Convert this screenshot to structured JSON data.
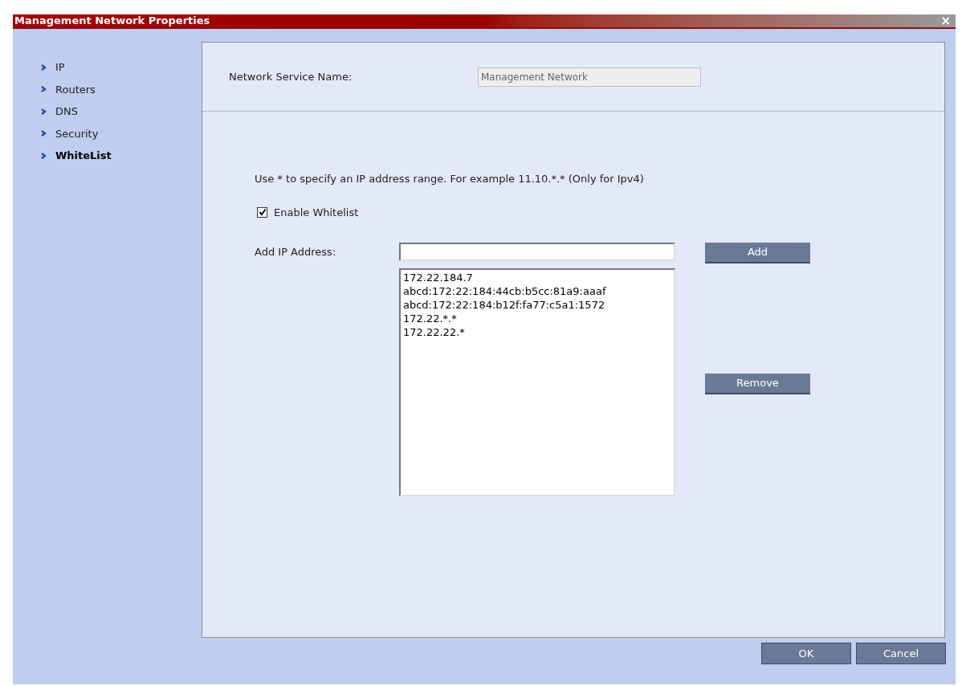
{
  "window": {
    "title": "Management Network Properties",
    "close": "×"
  },
  "sidebar": {
    "items": [
      {
        "label": "IP",
        "selected": false
      },
      {
        "label": "Routers",
        "selected": false
      },
      {
        "label": "DNS",
        "selected": false
      },
      {
        "label": "Security",
        "selected": false
      },
      {
        "label": "WhiteList",
        "selected": true
      }
    ]
  },
  "service_name": {
    "label": "Network Service Name:",
    "value": "Management Network",
    "disabled": true
  },
  "hint": "Use * to specify an IP address range. For example 11.10.*.* (Only for Ipv4)",
  "enable_whitelist": {
    "label": "Enable Whitelist",
    "checked": true
  },
  "add_ip": {
    "label": "Add IP Address:",
    "button": "Add"
  },
  "addresses": [
    "172.22.184.7",
    "abcd:172:22:184:44cb:b5cc:81a9:aaaf",
    "abcd:172:22:184:b12f:fa77:c5a1:1572",
    "172.22.*.*",
    "172.22.22.*"
  ],
  "remove_button": "Remove",
  "buttons": [
    "OK",
    "Cancel"
  ]
}
